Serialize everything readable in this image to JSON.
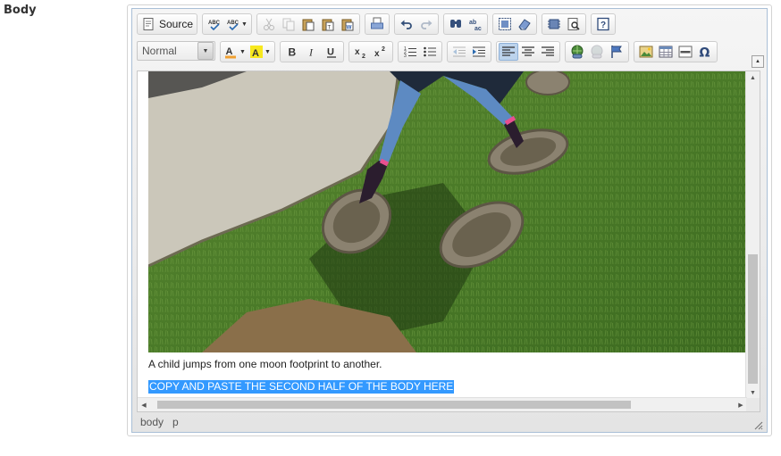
{
  "field": {
    "label": "Body"
  },
  "toolbar": {
    "source_label": "Source",
    "format_value": "Normal",
    "row1": [
      [
        "spellcheck-icon",
        "spellcheck-dropdown-icon"
      ],
      [
        "cut-icon",
        "copy-icon",
        "paste-icon",
        "paste-text-icon",
        "paste-word-icon"
      ],
      [
        "print-icon"
      ],
      [
        "undo-icon",
        "redo-icon"
      ],
      [
        "find-icon",
        "replace-icon"
      ],
      [
        "select-all-icon",
        "remove-format-icon"
      ],
      [
        "show-blocks-icon",
        "preview-icon"
      ],
      [
        "help-icon"
      ]
    ],
    "row2": [
      [
        "text-color-icon",
        "background-color-icon"
      ],
      [
        "bold-icon",
        "italic-icon",
        "underline-icon"
      ],
      [
        "subscript-icon",
        "superscript-icon"
      ],
      [
        "numbered-list-icon",
        "bulleted-list-icon"
      ],
      [
        "outdent-icon",
        "indent-icon"
      ],
      [
        "align-left-icon",
        "align-center-icon",
        "align-right-icon"
      ],
      [
        "link-icon",
        "unlink-icon",
        "anchor-icon"
      ],
      [
        "image-icon",
        "table-icon",
        "horizontal-rule-icon",
        "special-char-icon"
      ]
    ]
  },
  "content": {
    "caption": "A child jumps from one moon footprint to another.",
    "selected_text": "COPY AND PASTE THE SECOND HALF OF THE BODY HERE"
  },
  "pathbar": {
    "items": [
      "body",
      "p"
    ]
  },
  "colors": {
    "selection": "#3399ff",
    "editor_border": "#a9bfd6",
    "grass": "#4f7a2a"
  }
}
